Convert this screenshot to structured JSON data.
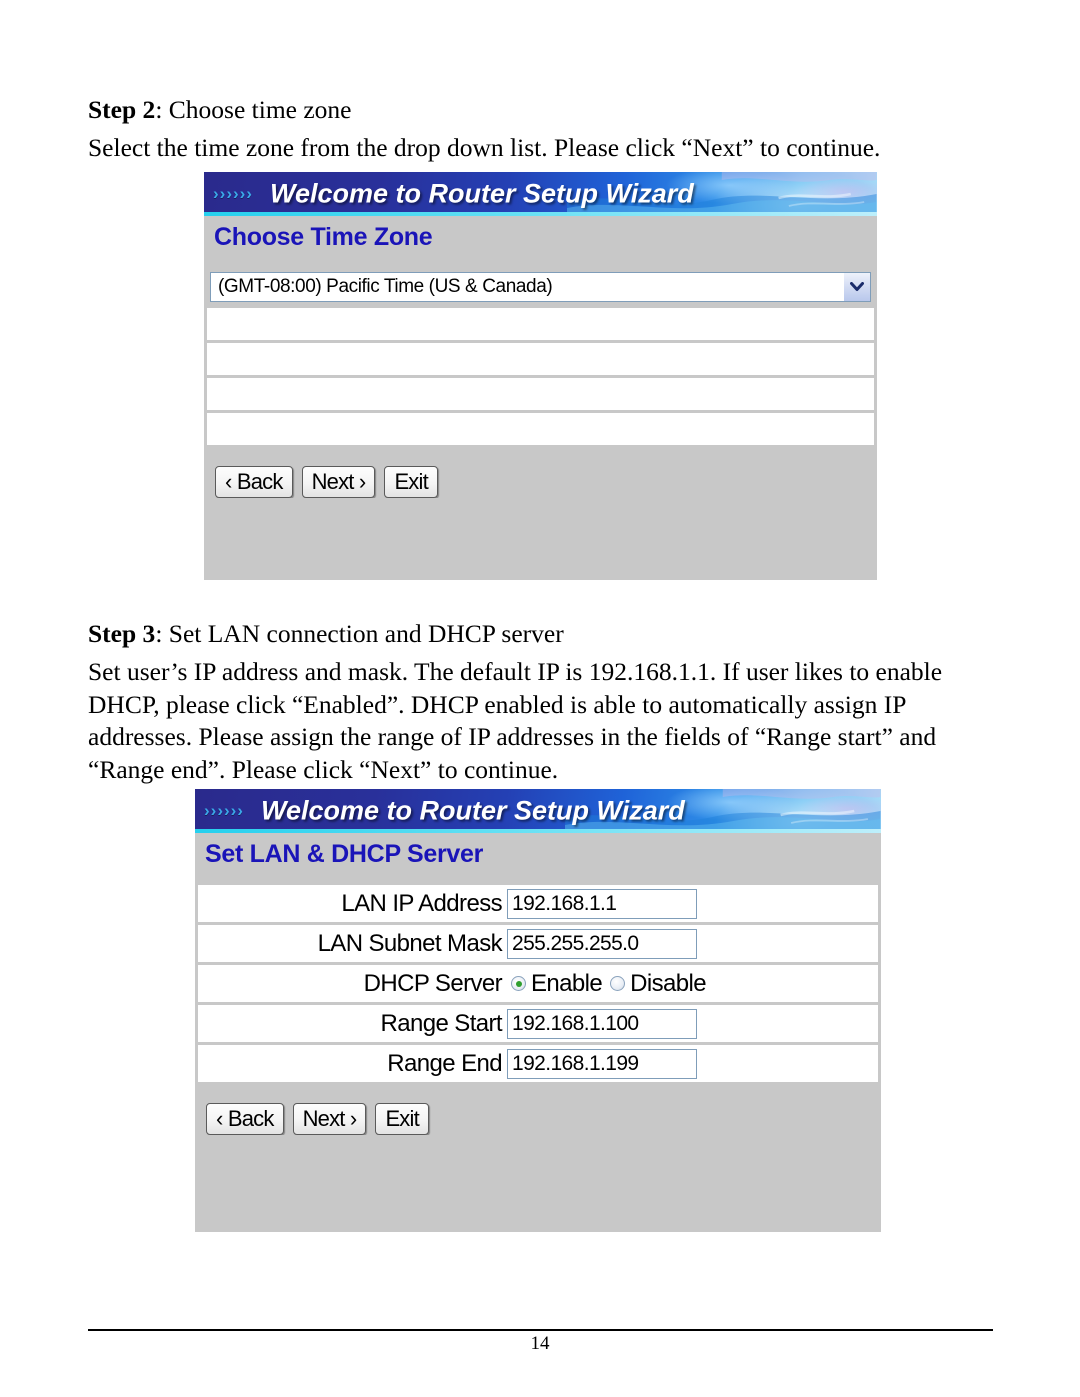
{
  "document": {
    "page_number": "14",
    "step2": {
      "heading_label": "Step 2",
      "heading_rest": ": Choose time zone",
      "paragraph": "Select the time zone from the drop down list. Please click “Next” to continue."
    },
    "step3": {
      "heading_label": "Step 3",
      "heading_rest": ": Set LAN connection and DHCP server",
      "paragraph": "Set user’s IP address and mask. The default IP is 192.168.1.1. If user likes to enable DHCP, please click “Enabled”. DHCP enabled is able to automatically assign IP addresses. Please assign the range of IP addresses in the fields of “Range start” and “Range end”. Please click “Next” to continue."
    }
  },
  "wizard_timezone": {
    "banner_chevrons": "››››››",
    "banner_title": "Welcome to Router Setup Wizard",
    "subtitle": "Choose Time Zone",
    "timezone_select": {
      "value": "(GMT-08:00) Pacific Time (US & Canada)",
      "arrow_icon": "chevron-down-icon"
    },
    "buttons": {
      "back": "‹ Back",
      "next": "Next ›",
      "exit": "Exit"
    }
  },
  "wizard_lan": {
    "banner_chevrons": "››››››",
    "banner_title": "Welcome to Router Setup Wizard",
    "subtitle": "Set LAN & DHCP Server",
    "fields": [
      {
        "label": "LAN IP Address",
        "value": "192.168.1.1"
      },
      {
        "label": "LAN Subnet Mask",
        "value": "255.255.255.0"
      },
      {
        "label": "Range Start",
        "value": "192.168.1.100"
      },
      {
        "label": "Range End",
        "value": "192.168.1.199"
      }
    ],
    "dhcp": {
      "label": "DHCP Server",
      "enable_label": "Enable",
      "disable_label": "Disable",
      "selected": "Enable"
    },
    "buttons": {
      "back": "‹ Back",
      "next": "Next ›",
      "exit": "Exit"
    }
  },
  "colors": {
    "banner_dark": "#2a2a8c",
    "banner_light": "#a9dcf7",
    "banner_underline": "#25d0ee",
    "subtitle_blue": "#1a14b8",
    "panel_gray": "#c8c8c8",
    "radio_selected_green": "#2f9e2f",
    "field_border": "#7f9db9"
  }
}
